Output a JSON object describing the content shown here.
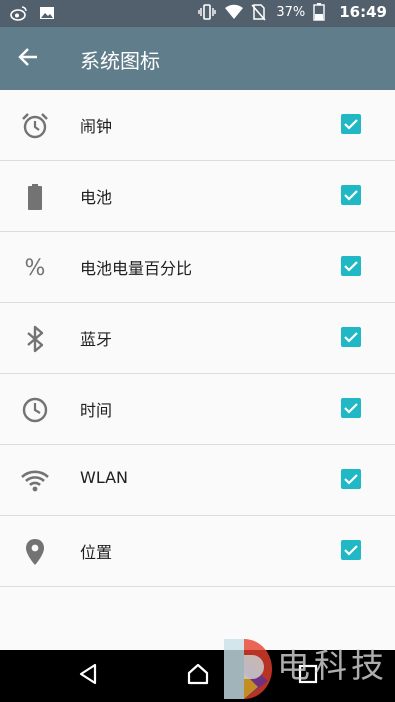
{
  "status_bar": {
    "battery_percent": "37%",
    "time": "16:49",
    "icons_left": [
      "weibo-icon",
      "image-icon"
    ],
    "icons_right": [
      "vibrate-icon",
      "wifi-icon",
      "no-sim-icon",
      "battery-icon"
    ]
  },
  "app_bar": {
    "title": "系统图标",
    "back_icon": "arrow-back-icon"
  },
  "items": [
    {
      "label": "闹钟",
      "icon": "alarm-icon",
      "checked": true
    },
    {
      "label": "电池",
      "icon": "battery-icon",
      "checked": true
    },
    {
      "label": "电池电量百分比",
      "icon": "percent-icon",
      "checked": true,
      "icon_text": "%"
    },
    {
      "label": "蓝牙",
      "icon": "bluetooth-icon",
      "checked": true
    },
    {
      "label": "时间",
      "icon": "clock-icon",
      "checked": true
    },
    {
      "label": "WLAN",
      "icon": "wifi-icon",
      "checked": true
    },
    {
      "label": "位置",
      "icon": "location-pin-icon",
      "checked": true
    }
  ],
  "colors": {
    "status_bar": "#52606d",
    "app_bar": "#607d8b",
    "checkbox": "#21b8c6",
    "background": "#fafafa",
    "icon_gray": "#737373"
  },
  "watermark": {
    "text": "电科技"
  }
}
